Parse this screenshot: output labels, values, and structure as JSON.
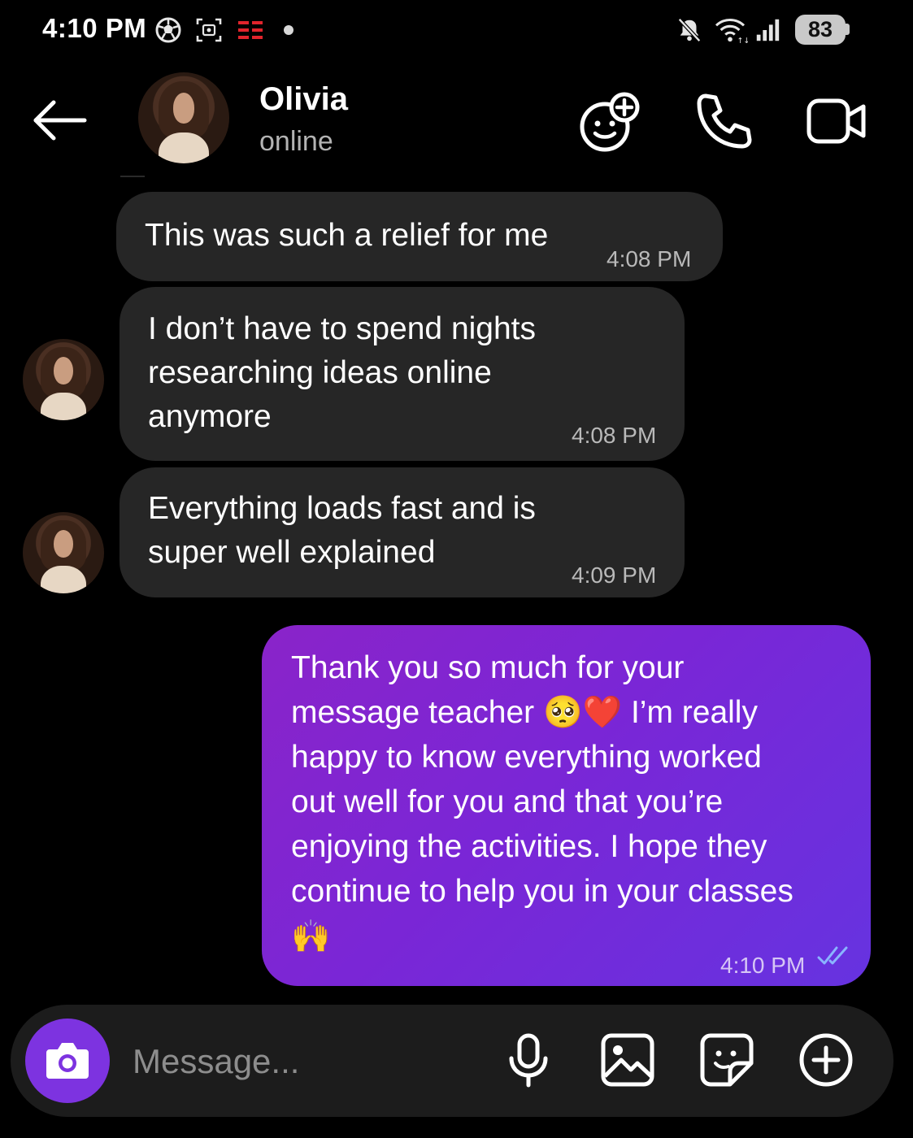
{
  "status_bar": {
    "time": "4:10 PM",
    "battery": "83",
    "icons": [
      "soccer-ball-icon",
      "screen-capture-icon",
      "carrier-logo-icon",
      "notification-dot",
      "mute-icon",
      "wifi-icon",
      "signal-icon",
      "battery-icon"
    ]
  },
  "header": {
    "name": "Olivia",
    "status": "online",
    "actions": [
      "add-emoji-icon",
      "phone-icon",
      "video-call-icon"
    ]
  },
  "messages": [
    {
      "direction": "incoming",
      "text": "This was such a relief for me",
      "time": "4:08 PM",
      "show_avatar": false
    },
    {
      "direction": "incoming",
      "lines": [
        "I don’t have to spend nights",
        "researching ideas online",
        "anymore"
      ],
      "time": "4:08 PM",
      "show_avatar": true
    },
    {
      "direction": "incoming",
      "lines": [
        "Everything loads fast and is",
        "super well explained"
      ],
      "time": "4:09 PM",
      "show_avatar": true
    },
    {
      "direction": "outgoing",
      "lines": [
        "Thank you so much for your",
        "message teacher 🥺❤️ I’m really",
        "happy to know everything worked",
        "out well for you and that you’re",
        "enjoying the activities. I hope they",
        "continue to help you in your classes",
        "🙌"
      ],
      "time": "4:10 PM",
      "status": "read"
    }
  ],
  "composer": {
    "placeholder": "Message...",
    "icons": [
      "camera-icon",
      "microphone-icon",
      "gallery-icon",
      "sticker-icon",
      "plus-icon"
    ]
  },
  "colors": {
    "background": "#000000",
    "incoming_bubble": "#262626",
    "outgoing_gradient": [
      "#8a24c9",
      "#6633e0"
    ],
    "accent": "#7d33e0",
    "read_ticks": "#8ab4ff"
  }
}
